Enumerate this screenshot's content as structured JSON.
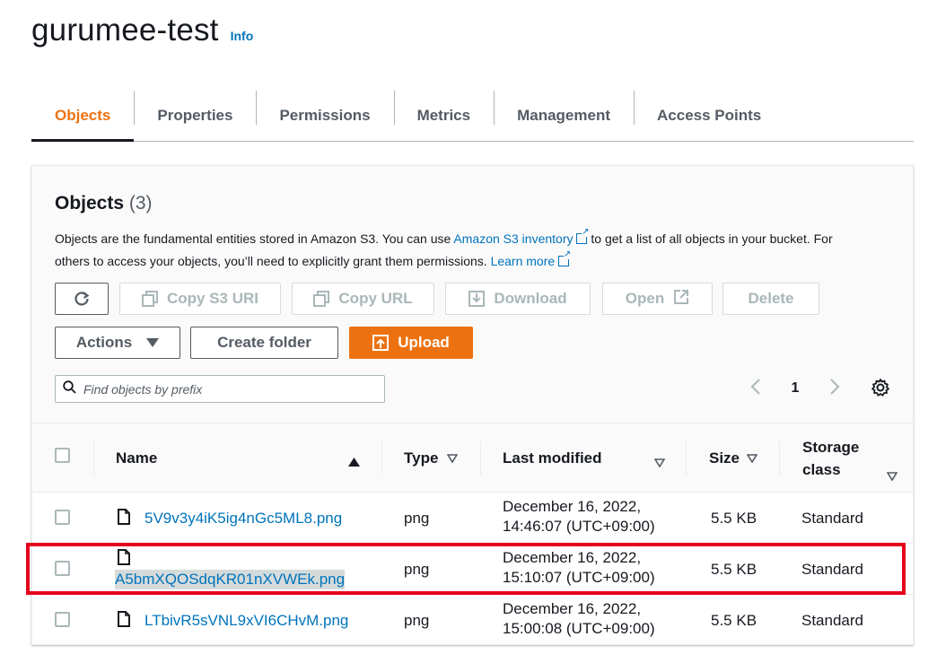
{
  "header": {
    "title": "gurumee-test",
    "info": "Info"
  },
  "tabs": [
    "Objects",
    "Properties",
    "Permissions",
    "Metrics",
    "Management",
    "Access Points"
  ],
  "objects": {
    "title": "Objects",
    "count": "(3)",
    "desc_1": "Objects are the fundamental entities stored in Amazon S3. You can use ",
    "desc_link_1": "Amazon S3 inventory",
    "desc_2": " to get a list of all objects in your bucket. For others to access your objects, you’ll need to explicitly grant them permissions. ",
    "desc_link_2": "Learn more"
  },
  "toolbar": {
    "copy_s3_uri": "Copy S3 URI",
    "copy_url": "Copy URL",
    "download": "Download",
    "open": "Open",
    "delete": "Delete",
    "actions": "Actions",
    "create_folder": "Create folder",
    "upload": "Upload"
  },
  "search": {
    "placeholder": "Find objects by prefix"
  },
  "pager": {
    "page": "1"
  },
  "columns": {
    "name": "Name",
    "type": "Type",
    "last_modified": "Last modified",
    "size": "Size",
    "storage_line1": "Storage",
    "storage_line2": "class"
  },
  "rows": [
    {
      "name": "5V9v3y4iK5ig4nGc5ML8.png",
      "type": "png",
      "date": "December 16, 2022,",
      "time": "14:46:07 (UTC+09:00)",
      "size": "5.5 KB",
      "storage": "Standard"
    },
    {
      "name": "A5bmXQOSdqKR01nXVWEk.png",
      "type": "png",
      "date": "December 16, 2022,",
      "time": "15:10:07 (UTC+09:00)",
      "size": "5.5 KB",
      "storage": "Standard"
    },
    {
      "name": "LTbivR5sVNL9xVI6CHvM.png",
      "type": "png",
      "date": "December 16, 2022,",
      "time": "15:00:08 (UTC+09:00)",
      "size": "5.5 KB",
      "storage": "Standard"
    }
  ],
  "colors": {
    "accent": "#ec7211",
    "link": "#0073bb",
    "highlight": "#e5001c"
  }
}
